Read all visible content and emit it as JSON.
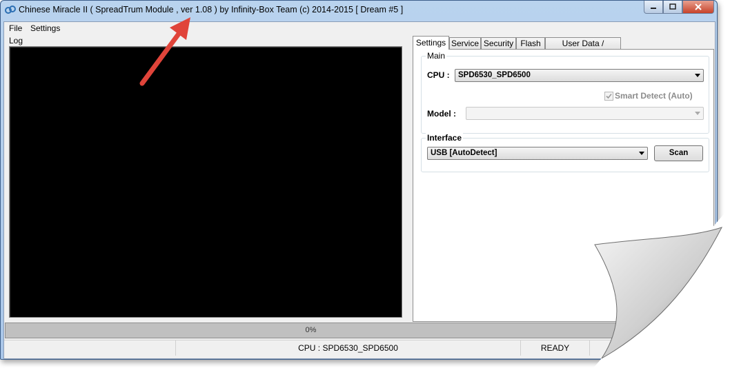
{
  "window": {
    "title": "Chinese Miracle II ( SpreadTrum Module , ver 1.08 ) by Infinity-Box Team (c) 2014-2015 [ Dream #5 ]"
  },
  "menu": {
    "file": "File",
    "settings": "Settings"
  },
  "log": {
    "label": "Log"
  },
  "tabs": [
    "Settings",
    "Service",
    "Security",
    "Flash",
    "User Data / Forensic"
  ],
  "main_group": {
    "title": "Main",
    "cpu_label": "CPU :",
    "cpu_value": "SPD6530_SPD6500",
    "smart_detect_label": "Smart Detect (Auto)",
    "smart_detect_checked": true,
    "model_label": "Model :",
    "model_value": ""
  },
  "interface_group": {
    "title": "Interface",
    "value": "USB [AutoDetect]",
    "scan_label": "Scan"
  },
  "progress": {
    "text": "0%",
    "value": 0
  },
  "status": {
    "left": "",
    "cpu": "CPU : SPD6530_SPD6500",
    "state": "READY",
    "right": ""
  },
  "colors": {
    "annotation_arrow": "#e0443a",
    "log_background": "#000000"
  }
}
